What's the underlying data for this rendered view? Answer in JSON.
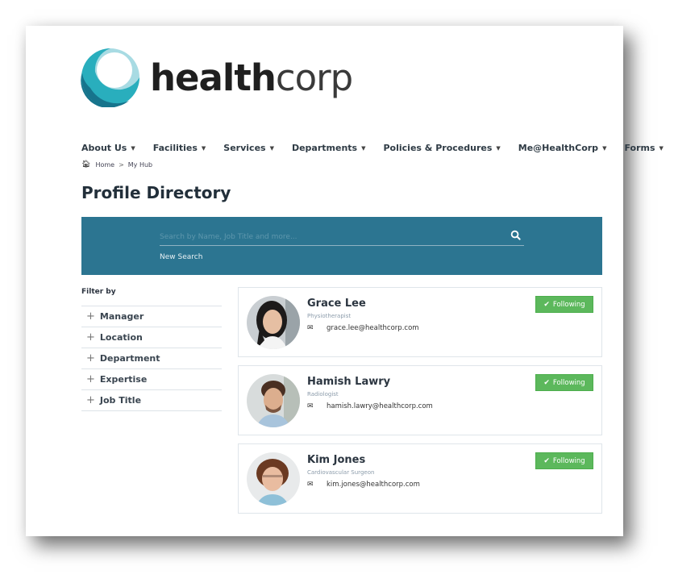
{
  "brand": {
    "name_bold": "health",
    "name_light": "corp",
    "logo_colors": {
      "light": "#a8dbe3",
      "mid": "#29aebd",
      "dark": "#17748c"
    }
  },
  "nav": {
    "items": [
      {
        "label": "About Us"
      },
      {
        "label": "Facilities"
      },
      {
        "label": "Services"
      },
      {
        "label": "Departments"
      },
      {
        "label": "Policies & Procedures"
      },
      {
        "label": "Me@HealthCorp"
      },
      {
        "label": "Forms"
      }
    ],
    "caret_icon": "▼"
  },
  "breadcrumb": {
    "home_icon": "home-icon",
    "items": [
      {
        "label": "Home"
      },
      {
        "label": "My Hub"
      }
    ],
    "separator": ">"
  },
  "page": {
    "title": "Profile Directory"
  },
  "search": {
    "placeholder": "Search by Name, Job Title and more...",
    "value": "",
    "new_search_label": "New Search",
    "band_color": "#2c7591"
  },
  "filter": {
    "label": "Filter by",
    "items": [
      {
        "label": "Manager"
      },
      {
        "label": "Location"
      },
      {
        "label": "Department"
      },
      {
        "label": "Expertise"
      },
      {
        "label": "Job Title"
      }
    ]
  },
  "profiles": [
    {
      "name": "Grace Lee",
      "title": "Physiotherapist",
      "email": "grace.lee@healthcorp.com",
      "follow_label": "Following"
    },
    {
      "name": "Hamish Lawry",
      "title": "Radiologist",
      "email": "hamish.lawry@healthcorp.com",
      "follow_label": "Following"
    },
    {
      "name": "Kim Jones",
      "title": "Cardiovascular Surgeon",
      "email": "kim.jones@healthcorp.com",
      "follow_label": "Following"
    }
  ],
  "colors": {
    "follow_button": "#5cb85c",
    "title_text": "#222f3a"
  }
}
